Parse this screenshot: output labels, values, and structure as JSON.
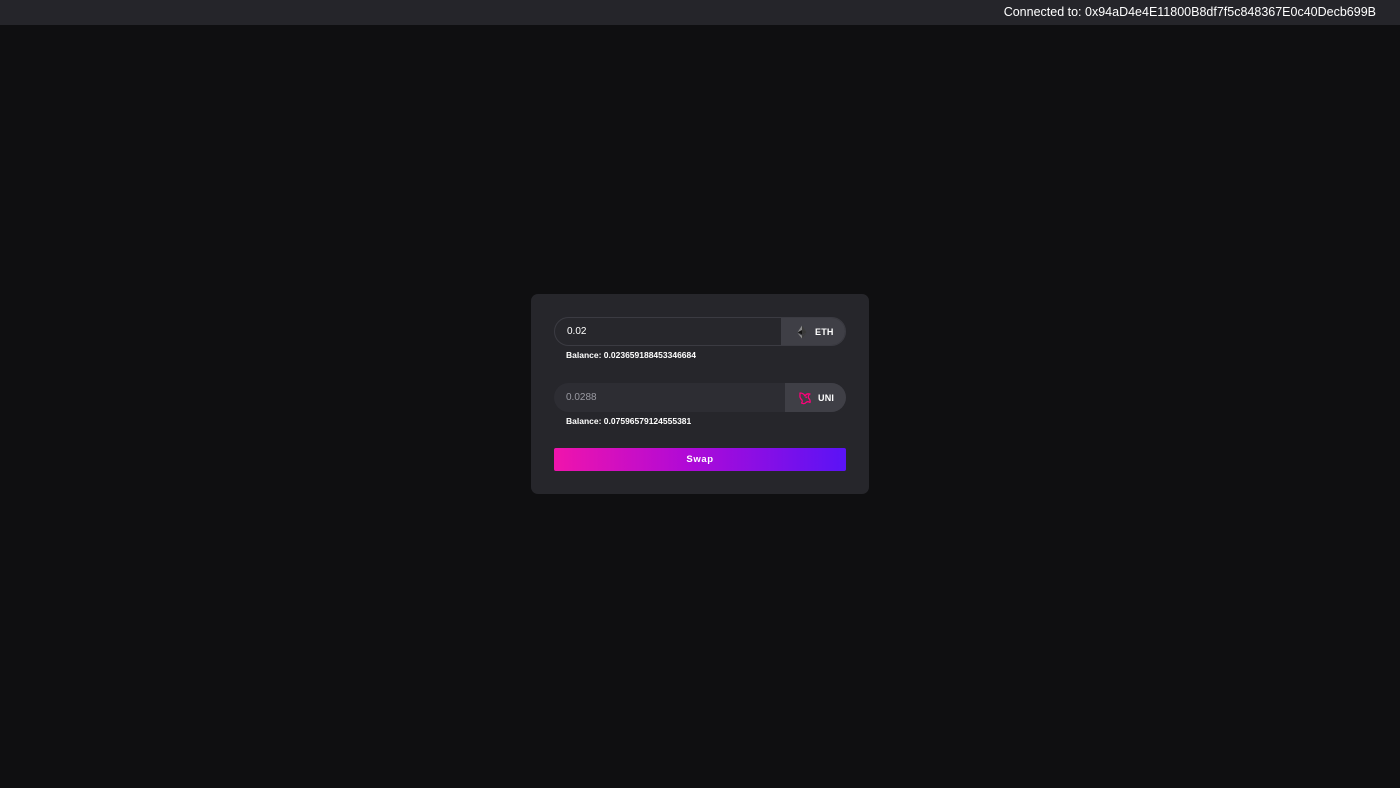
{
  "header": {
    "connected_text": "Connected to: 0x94aD4e4E11800B8df7f5c848367E0c40Decb699B"
  },
  "swap_card": {
    "from": {
      "amount": "0.02",
      "token_symbol": "ETH",
      "token_icon": "ethereum-icon",
      "balance_text": "Balance: 0.023659188453346684"
    },
    "to": {
      "amount_placeholder": "0.0288",
      "token_symbol": "UNI",
      "token_icon": "uniswap-icon",
      "balance_text": "Balance: 0.07596579124555381"
    },
    "swap_label": "Swap"
  },
  "colors": {
    "background": "#0f0f11",
    "topbar": "#25252a",
    "card": "#26262b",
    "gradient_start": "#f014ac",
    "gradient_end": "#5a13f6",
    "uni_pink": "#ff007a"
  }
}
